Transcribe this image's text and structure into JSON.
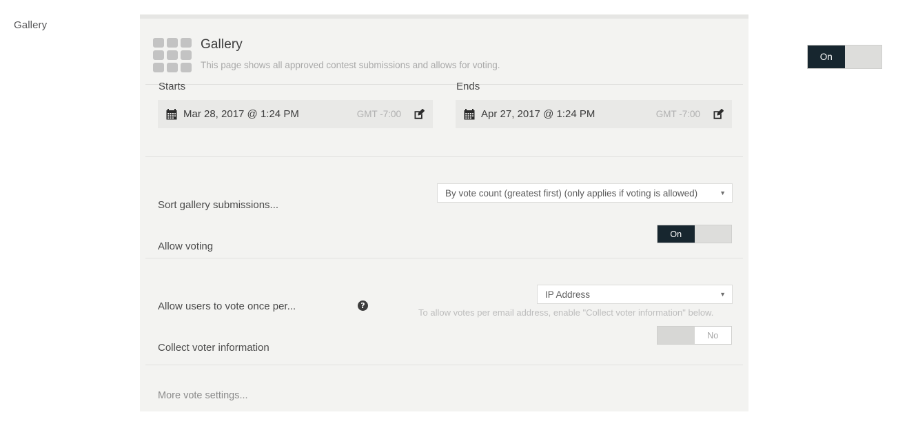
{
  "rail": {
    "label": "Gallery"
  },
  "panel": {
    "header": {
      "icon": "grid-3x3-icon",
      "title": "Gallery",
      "subtitle": "This page shows all approved contest submissions and allows for voting.",
      "toggle": {
        "state_label": "On",
        "blank_label": ""
      }
    },
    "schedule": {
      "starts": {
        "label": "Starts",
        "calendar_icon": "calendar-icon",
        "value": "Mar 28, 2017 @ 1:24 PM",
        "timezone": "GMT -7:00",
        "edit_icon": "pencil-edit-icon"
      },
      "ends": {
        "label": "Ends",
        "calendar_icon": "calendar-icon",
        "value": "Apr 27, 2017 @ 1:24 PM",
        "timezone": "GMT -7:00",
        "edit_icon": "pencil-edit-icon"
      }
    },
    "sort": {
      "label": "Sort gallery submissions...",
      "selected": "By vote count (greatest first) (only applies if voting is allowed)",
      "caret": "▼"
    },
    "allow_voting": {
      "label": "Allow voting",
      "toggle": {
        "state_label": "On",
        "blank_label": ""
      }
    },
    "vote_frequency": {
      "label": "Allow users to vote once per...",
      "help_icon": "help-circle-icon",
      "help_glyph": "?",
      "selected": "IP Address",
      "caret": "▼",
      "hint": "To allow votes per email address, enable \"Collect voter information\" below."
    },
    "collect_voter_info": {
      "label": "Collect voter information",
      "toggle": {
        "blank_label": "",
        "state_label": "No"
      }
    },
    "more_settings": {
      "label": "More vote settings..."
    }
  },
  "colors": {
    "page_background": "#ffffff",
    "panel_background": "#f3f3f1",
    "panel_top_strip": "#e6e6e4",
    "toggle_on": "#17262f",
    "toggle_track": "#dddddb",
    "field_background": "#e9e9e7",
    "divider": "#e0e0de",
    "muted_text": "#b0b0b0"
  }
}
